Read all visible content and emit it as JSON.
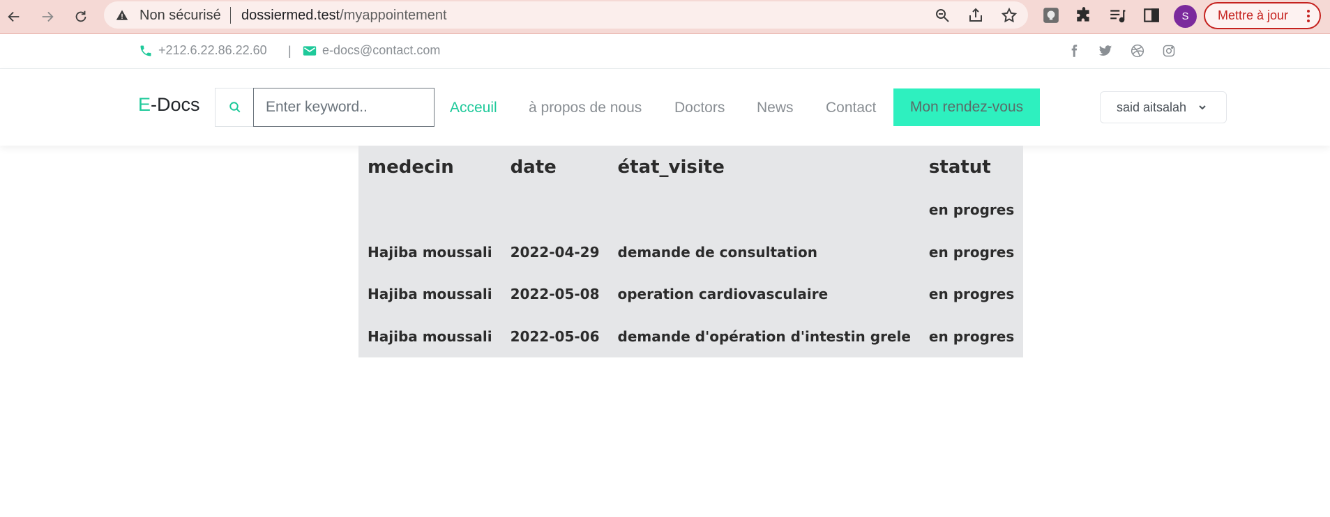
{
  "browser": {
    "insecure_label": "Non sécurisé",
    "url_host": "dossiermed.test",
    "url_path": "/myappointement",
    "profile_initial": "S",
    "update_label": "Mettre à jour",
    "icons": [
      "back-icon",
      "forward-icon",
      "reload-icon",
      "warning-icon",
      "zoom-icon",
      "share-icon",
      "star-icon",
      "extension-icon",
      "puzzle-icon",
      "media-icon",
      "sidepanel-icon",
      "kebab-icon"
    ],
    "accent_color": "#c5221f"
  },
  "topbar": {
    "phone": "+212.6.22.86.22.60",
    "divider": "|",
    "email": "e-docs@contact.com",
    "social": [
      "facebook-icon",
      "twitter-icon",
      "dribbble-icon",
      "instagram-icon"
    ]
  },
  "nav": {
    "brand_accent": "E",
    "brand_rest": "-Docs",
    "search_placeholder": "Enter keyword..",
    "links": [
      {
        "label": "Acceuil",
        "active": true
      },
      {
        "label": "à propos de nous"
      },
      {
        "label": "Doctors"
      },
      {
        "label": "News"
      },
      {
        "label": "Contact"
      }
    ],
    "cta_label": "Mon rendez-vous",
    "user_name": "said aitsalah",
    "brand_color": "#1ec99a",
    "cta_color": "#2ef0bf"
  },
  "table": {
    "headers": [
      "medecin",
      "date",
      "état_visite",
      "statut"
    ],
    "rows": [
      [
        "",
        "",
        "",
        "en progres"
      ],
      [
        "Hajiba moussali",
        "2022-04-29",
        "demande de consultation",
        "en progres"
      ],
      [
        "Hajiba moussali",
        "2022-05-08",
        "operation cardiovasculaire",
        "en progres"
      ],
      [
        "Hajiba moussali",
        "2022-05-06",
        "demande d'opération d'intestin grele",
        "en progres"
      ]
    ]
  }
}
